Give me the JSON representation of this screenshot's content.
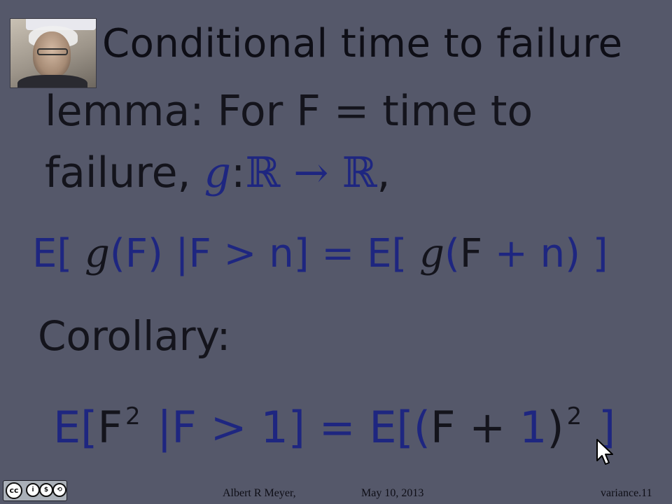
{
  "slide": {
    "title": "Conditional time to failure",
    "lemma_line1": {
      "prefix": "lemma: For F ",
      "eq": "=",
      "suffix": " time to"
    },
    "lemma_line2": {
      "prefix": "failure, ",
      "g": "g",
      "colon": ":",
      "domain": "ℝ",
      "arrow": " → ",
      "codomain": "ℝ",
      "comma": ","
    },
    "equation1": {
      "lhs_open": "E[ ",
      "g1": "g",
      "arg1": "(F) ",
      "bar": "|",
      "cond": "F ",
      "gt": ">",
      "n1": " n",
      "close1": "] ",
      "eq": "=",
      "rhs_open": " E[ ",
      "g2": "g",
      "arg2_open": "(",
      "F2": "F ",
      "plus": "+",
      "n2": " n",
      "arg2_close": ") ]"
    },
    "corollary_label": "Corollary:",
    "equation2": {
      "lhs_open": "E[",
      "F1": "F",
      "sq1": "2",
      "bar": " |",
      "F2": "F ",
      "gt": ">",
      "one1": " 1",
      "close1": "]",
      "eq": " = ",
      "rhs_open": "E[(",
      "F3": "F",
      "plus": " + ",
      "one2": "1",
      "paren_close": ")",
      "sq2": "2",
      "close2": " ]"
    }
  },
  "footer": {
    "author": "Albert R Meyer,",
    "date": "May 10, 2013",
    "slide_id": "variance.11"
  },
  "license_badge": {
    "icons": [
      "cc",
      "by",
      "nc",
      "sa"
    ]
  },
  "colors": {
    "background": "#55586a",
    "ink_dark": "#14141c",
    "ink_blue": "#1e2680"
  }
}
